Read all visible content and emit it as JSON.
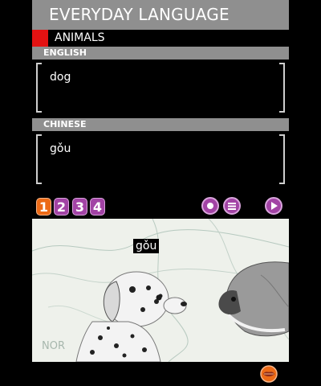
{
  "header": {
    "title": "EVERYDAY LANGUAGE"
  },
  "category": {
    "label": "ANIMALS",
    "marker_color": "#e31212"
  },
  "english": {
    "section_label": "ENGLISH",
    "text": "dog"
  },
  "chinese": {
    "section_label": "CHINESE",
    "text": "gǒu"
  },
  "controls": {
    "numbers": [
      {
        "label": "1",
        "active": true
      },
      {
        "label": "2",
        "active": false
      },
      {
        "label": "3",
        "active": false
      },
      {
        "label": "4",
        "active": false
      }
    ],
    "accent_orange": "#ec6a16",
    "accent_purple": "#a243a5",
    "icons": [
      "record-icon",
      "list-icon",
      "play-icon"
    ]
  },
  "scene": {
    "word_tag": "gǒu",
    "map_text": "NOR",
    "images": [
      "dalmatian-puppy",
      "bird"
    ]
  },
  "footer": {
    "icon": "lips-icon"
  }
}
